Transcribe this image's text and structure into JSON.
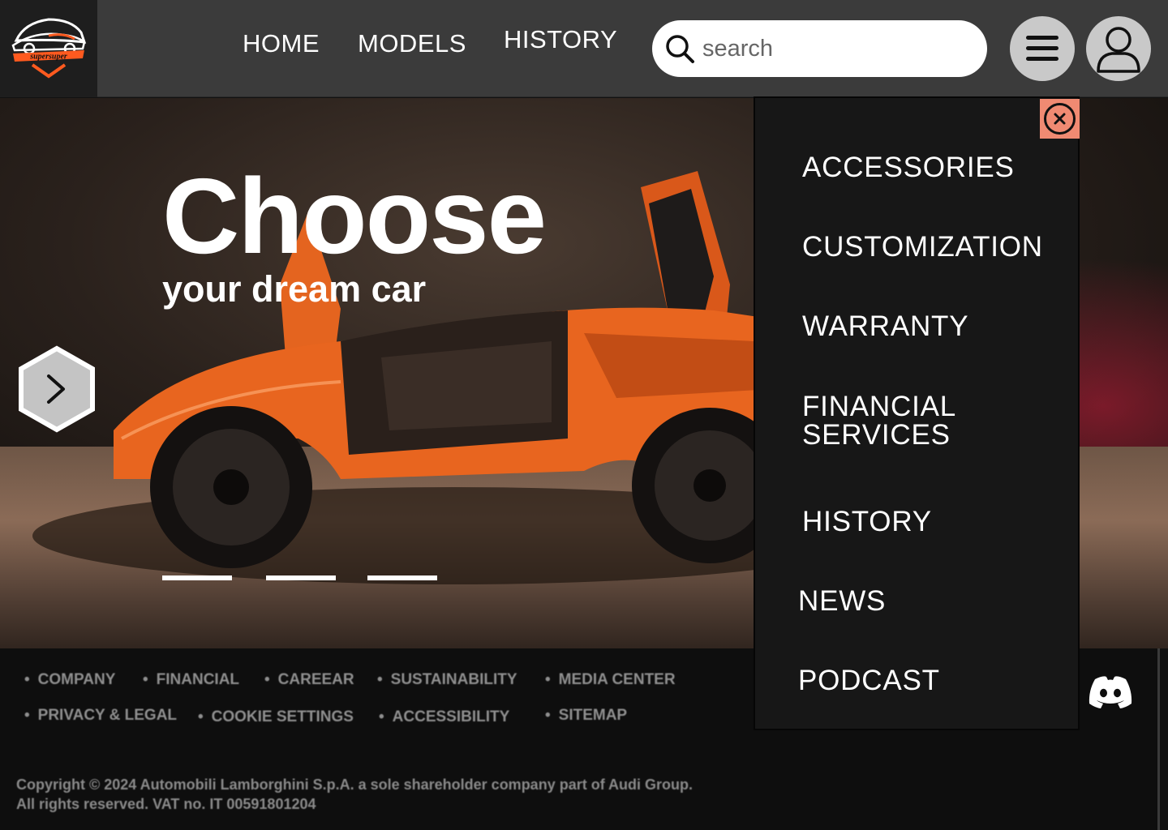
{
  "brand": {
    "logo_text": "supersuper",
    "accent": "#ff5a1f"
  },
  "nav": {
    "home": "HOME",
    "models": "MODELS",
    "history": "HISTORY"
  },
  "search": {
    "placeholder": "search",
    "value": ""
  },
  "icons": {
    "search": "search-icon",
    "menu": "hamburger-menu-icon",
    "user": "user-profile-icon",
    "next": "chevron-right-icon",
    "close": "close-circle-icon",
    "discord": "discord-icon"
  },
  "hero": {
    "title": "Choose",
    "subtitle": "your dream car",
    "slide_count": 3
  },
  "menu": {
    "items": [
      "ACCESSORIES",
      "CUSTOMIZATION",
      "WARRANTY",
      "FINANCIAL SERVICES",
      "HISTORY",
      "NEWS",
      "PODCAST"
    ],
    "close_color": "#f08a72"
  },
  "footer": {
    "links_row1": [
      "COMPANY",
      "FINANCIAL",
      "CAREEAR",
      "SUSTAINABILITY",
      "MEDIA CENTER"
    ],
    "links_row2": [
      "PRIVACY & LEGAL",
      "COOKIE SETTINGS",
      "ACCESSIBILITY",
      "SITEMAP"
    ],
    "copyright_line1": "Copyright © 2024 Automobili Lamborghini S.p.A. a sole shareholder company part of Audi Group.",
    "copyright_line2": "All rights reserved. VAT no. IT 00591801204"
  }
}
